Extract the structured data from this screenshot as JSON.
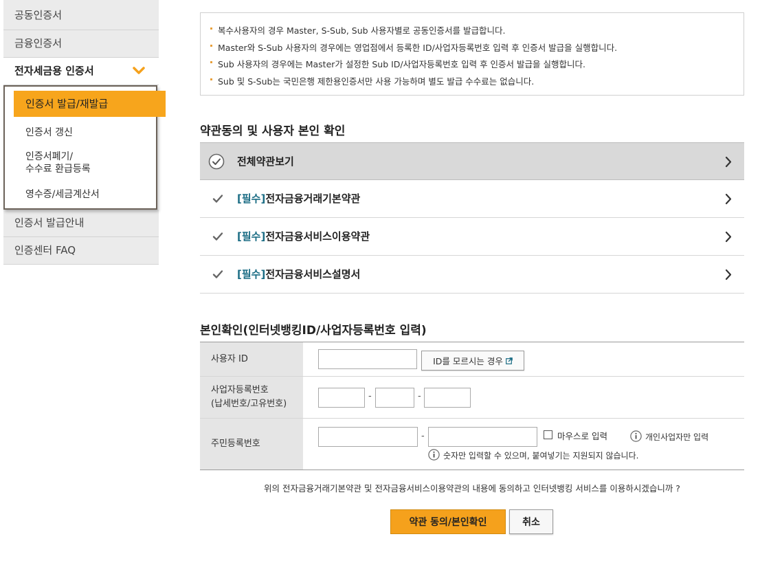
{
  "sidebar": {
    "items_before": [
      "공동인증서",
      "금융인증서"
    ],
    "active": "전자세금용 인증서",
    "submenu": [
      "인증서 발급/재발급",
      "인증서 갱신",
      "인증서폐기/",
      "수수료 환급등록",
      "영수증/세금계산서"
    ],
    "items_after": [
      "인증서 발급안내",
      "인증센터 FAQ"
    ]
  },
  "notice": [
    "복수사용자의 경우 Master, S-Sub, Sub 사용자별로 공동인증서를 발급합니다.",
    "Master와 S-Sub 사용자의 경우에는 영업점에서 등록한 ID/사업자등록번호 입력 후 인증서 발급을 실행합니다.",
    "Sub 사용자의 경우에는 Master가 설정한 Sub ID/사업자등록번호 입력 후 인증서 발급을 실행합니다.",
    "Sub 및 S-Sub는 국민은행 제한용인증서만 사용 가능하며 별도 발급 수수료는 없습니다."
  ],
  "terms": {
    "title": "약관동의 및 사용자 본인 확인",
    "all_label": "전체약관보기",
    "required_tag": "[필수]",
    "items": [
      "전자금융거래기본약관",
      "전자금융서비스이용약관",
      "전자금융서비스설명서"
    ]
  },
  "identity": {
    "title": "본인확인(인터넷뱅킹ID/사업자등록번호 입력)",
    "user_id_label": "사용자 ID",
    "forgot_id_button": "ID를 모르시는 경우",
    "biz_label_1": "사업자등록번호",
    "biz_label_2": "(납세번호/고유번호)",
    "rrn_label": "주민등록번호",
    "dash": "-",
    "mouse_input_label": "마우스로 입력",
    "individual_only_note": "개인사업자만 입력",
    "digits_only_note": "숫자만 입력할 수 있으며, 붙여넣기는 지원되지 않습니다."
  },
  "question": "위의 전자금융거래기본약관 및 전자금융서비스이용약관의 내용에 동의하고 인터넷뱅킹 서비스를 이용하시겠습니까 ?",
  "buttons": {
    "agree": "약관 동의/본인확인",
    "cancel": "취소"
  },
  "colors": {
    "accent": "#f5a11c",
    "required_tag": "#1a6c84",
    "notice_bullet": "#e8a03b"
  }
}
